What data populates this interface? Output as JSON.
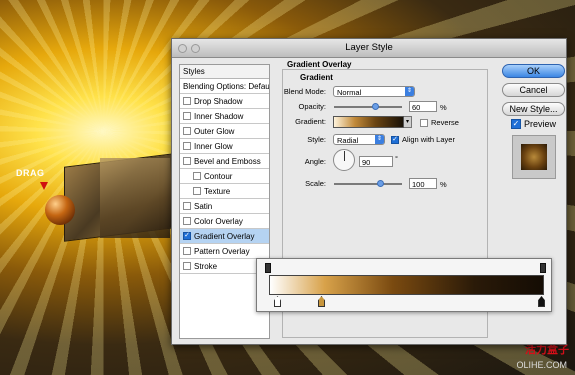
{
  "artwork": {
    "drag_label": "DRAG"
  },
  "watermark": {
    "line1": "活力盒子",
    "line2": "OLIHE.COM"
  },
  "dialog": {
    "title": "Layer Style"
  },
  "styles_panel": {
    "header": "Styles",
    "blending": "Blending Options: Default",
    "items": [
      {
        "label": "Drop Shadow",
        "checked": false,
        "indent": false
      },
      {
        "label": "Inner Shadow",
        "checked": false,
        "indent": false
      },
      {
        "label": "Outer Glow",
        "checked": false,
        "indent": false
      },
      {
        "label": "Inner Glow",
        "checked": false,
        "indent": false
      },
      {
        "label": "Bevel and Emboss",
        "checked": false,
        "indent": false
      },
      {
        "label": "Contour",
        "checked": false,
        "indent": true
      },
      {
        "label": "Texture",
        "checked": false,
        "indent": true
      },
      {
        "label": "Satin",
        "checked": false,
        "indent": false
      },
      {
        "label": "Color Overlay",
        "checked": false,
        "indent": false
      },
      {
        "label": "Gradient Overlay",
        "checked": true,
        "indent": false,
        "selected": true
      },
      {
        "label": "Pattern Overlay",
        "checked": false,
        "indent": false
      },
      {
        "label": "Stroke",
        "checked": false,
        "indent": false
      }
    ]
  },
  "gradient_overlay": {
    "title": "Gradient Overlay",
    "subtitle": "Gradient",
    "blend_mode_label": "Blend Mode:",
    "blend_mode_value": "Normal",
    "opacity_label": "Opacity:",
    "opacity_value": "60",
    "opacity_unit": "%",
    "opacity_level": 0.6,
    "gradient_label": "Gradient:",
    "reverse_label": "Reverse",
    "reverse_checked": false,
    "style_label": "Style:",
    "style_value": "Radial",
    "align_label": "Align with Layer",
    "align_checked": true,
    "angle_label": "Angle:",
    "angle_value": "90",
    "angle_unit": "°",
    "scale_label": "Scale:",
    "scale_value": "100",
    "scale_unit": "%",
    "scale_level": 0.67
  },
  "buttons": {
    "ok": "OK",
    "cancel": "Cancel",
    "new_style": "New Style...",
    "preview": "Preview"
  },
  "colors": {
    "accent": "#3b86e3",
    "selected_row": "#b5d3f2"
  }
}
